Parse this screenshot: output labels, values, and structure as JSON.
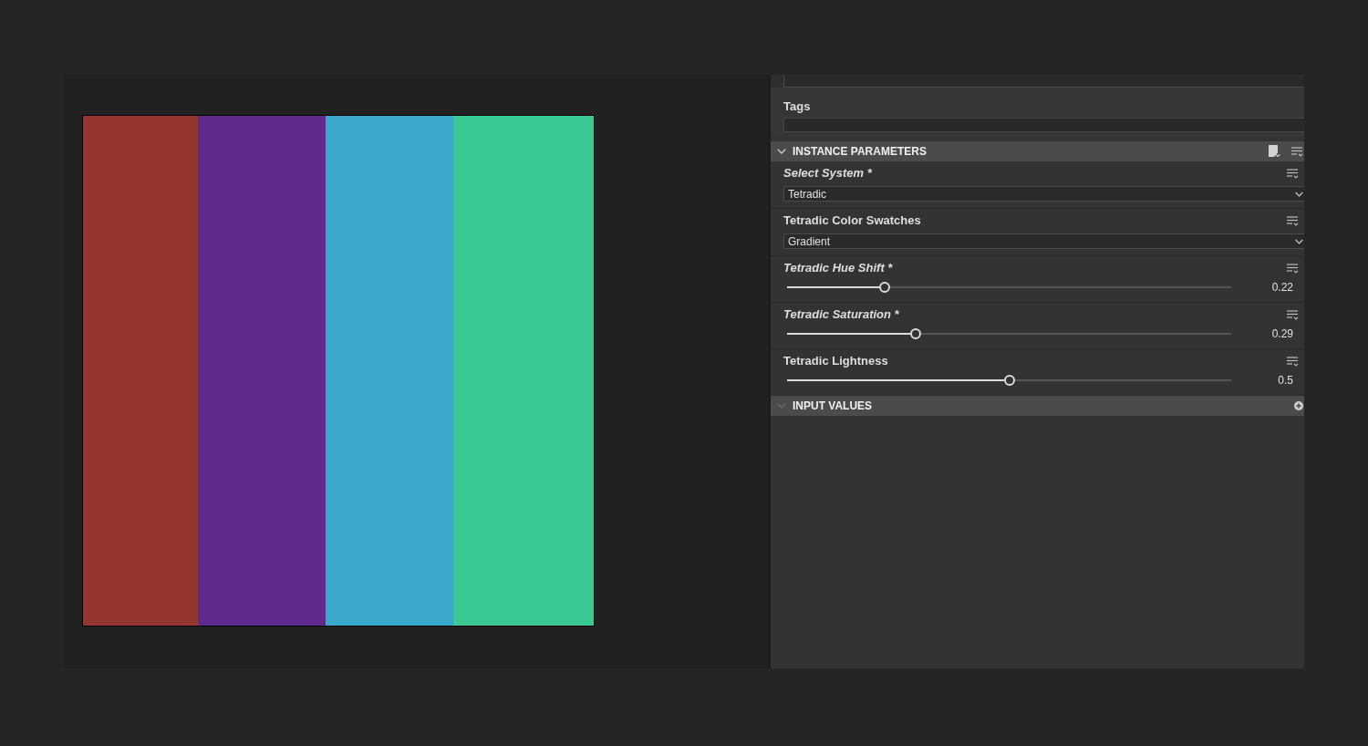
{
  "viewport": {
    "swatches": [
      {
        "color": "#943530"
      },
      {
        "color": "#5f2a8c"
      },
      {
        "color": "#3aa8cb"
      },
      {
        "color": "#3ac893"
      }
    ]
  },
  "properties": {
    "tags_label": "Tags"
  },
  "sections": [
    {
      "kind": "parameters",
      "title": "INSTANCE PARAMETERS",
      "expanded": true,
      "disabled": false,
      "parameters": [
        {
          "kind": "dropdown",
          "label": "Select System *",
          "modified": true,
          "value": "Tetradic"
        },
        {
          "kind": "dropdown",
          "label": "Tetradic Color Swatches",
          "modified": false,
          "value": "Gradient"
        },
        {
          "kind": "slider",
          "label": "Tetradic Hue Shift *",
          "modified": true,
          "level": 0.22,
          "reading": "0.22"
        },
        {
          "kind": "slider",
          "label": "Tetradic Saturation *",
          "modified": true,
          "level": 0.29,
          "reading": "0.29"
        },
        {
          "kind": "slider",
          "label": "Tetradic Lightness",
          "modified": false,
          "level": 0.5,
          "reading": "0.5"
        }
      ]
    },
    {
      "kind": "inputs",
      "title": "INPUT VALUES",
      "expanded": true,
      "disabled": true
    }
  ]
}
